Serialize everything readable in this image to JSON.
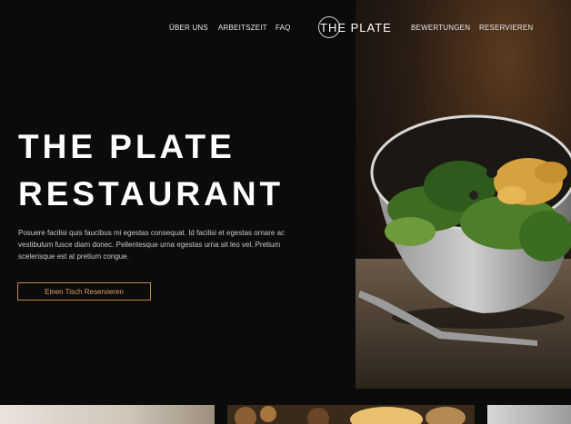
{
  "nav": {
    "left": [
      "ÜBER UNS",
      "ARBEITSZEIT",
      "FAQ"
    ],
    "logo": "THE PLATE",
    "right": [
      "BEWERTUNGEN",
      "RESERVIEREN"
    ]
  },
  "hero": {
    "title_line1": "THE PLATE",
    "title_line2": "RESTAURANT",
    "description": "Posuere facilisi quis faucibus mi egestas consequat. Id facilisi et egestas ornare ac vestibulum fusce diam donec. Pellentesque urna egestas urna sit leo vel. Pretium scelerisque est at pretium congue.",
    "cta_label": "Einen Tisch Reservieren"
  },
  "colors": {
    "background": "#0b0b0b",
    "accent": "#c7873f"
  }
}
